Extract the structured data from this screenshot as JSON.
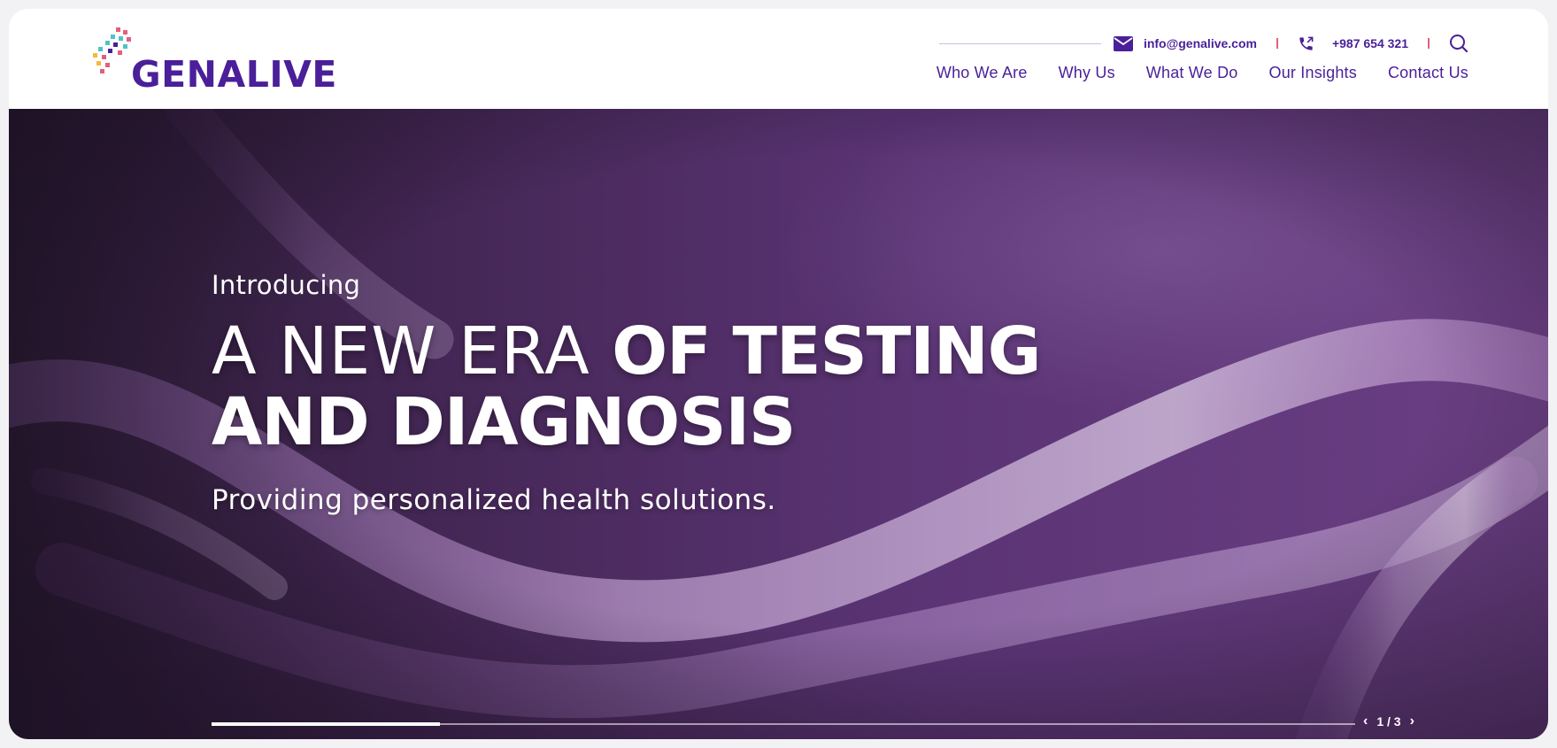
{
  "brand": {
    "name": "GENALIVE",
    "primary_color": "#4a1f99",
    "accent_color": "#e0607e"
  },
  "contact": {
    "email": "info@genalive.com",
    "email_icon": "envelope-icon",
    "phone": "+987 654 321",
    "phone_icon": "phone-icon",
    "search_icon": "search-icon"
  },
  "nav": {
    "items": [
      {
        "label": "Who We Are"
      },
      {
        "label": "Why Us"
      },
      {
        "label": "What We Do"
      },
      {
        "label": "Our Insights"
      },
      {
        "label": "Contact Us"
      }
    ]
  },
  "hero": {
    "intro": "Introducing",
    "headline_light": "A NEW ERA ",
    "headline_bold_1": "OF TESTING",
    "headline_bold_2": "AND DIAGNOSIS",
    "subline": "Providing personalized health solutions.",
    "slider": {
      "label": "1 / 3",
      "current": 1,
      "total": 3,
      "progress_fraction": 0.2,
      "prev_icon": "chevron-left-icon",
      "next_icon": "chevron-right-icon"
    }
  }
}
